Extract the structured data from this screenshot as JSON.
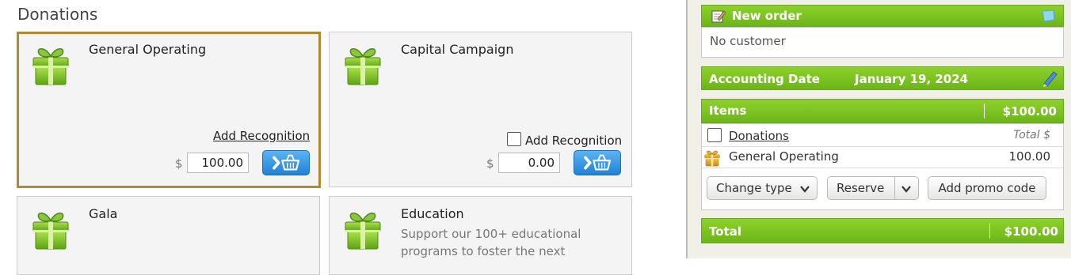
{
  "page": {
    "title": "Donations"
  },
  "donation_cards": [
    {
      "title": "General Operating",
      "add_recognition": "Add Recognition",
      "currency": "$",
      "amount": "100.00",
      "selected": true
    },
    {
      "title": "Capital Campaign",
      "add_recognition": "Add Recognition",
      "currency": "$",
      "amount": "0.00",
      "selected": false
    },
    {
      "title": "Gala"
    },
    {
      "title": "Education",
      "description_lines": [
        "Support our 100+ educational",
        "programs to foster the next"
      ]
    }
  ],
  "order": {
    "header_title": "New order",
    "customer": "No customer",
    "accounting_date_label": "Accounting Date",
    "accounting_date_value": "January 19, 2024",
    "items_label": "Items",
    "items_total": "$100.00",
    "group": {
      "name": "Donations",
      "total_col": "Total $"
    },
    "line_items": [
      {
        "name": "General Operating",
        "amount": "100.00"
      }
    ],
    "buttons": {
      "change_type": "Change type",
      "reserve": "Reserve",
      "promo": "Add promo code"
    },
    "total_label": "Total",
    "total_value": "$100.00"
  },
  "colors": {
    "accent_green": "#7cc420",
    "selected_border": "#b08a2e",
    "cart_blue": "#2a8ce0"
  }
}
